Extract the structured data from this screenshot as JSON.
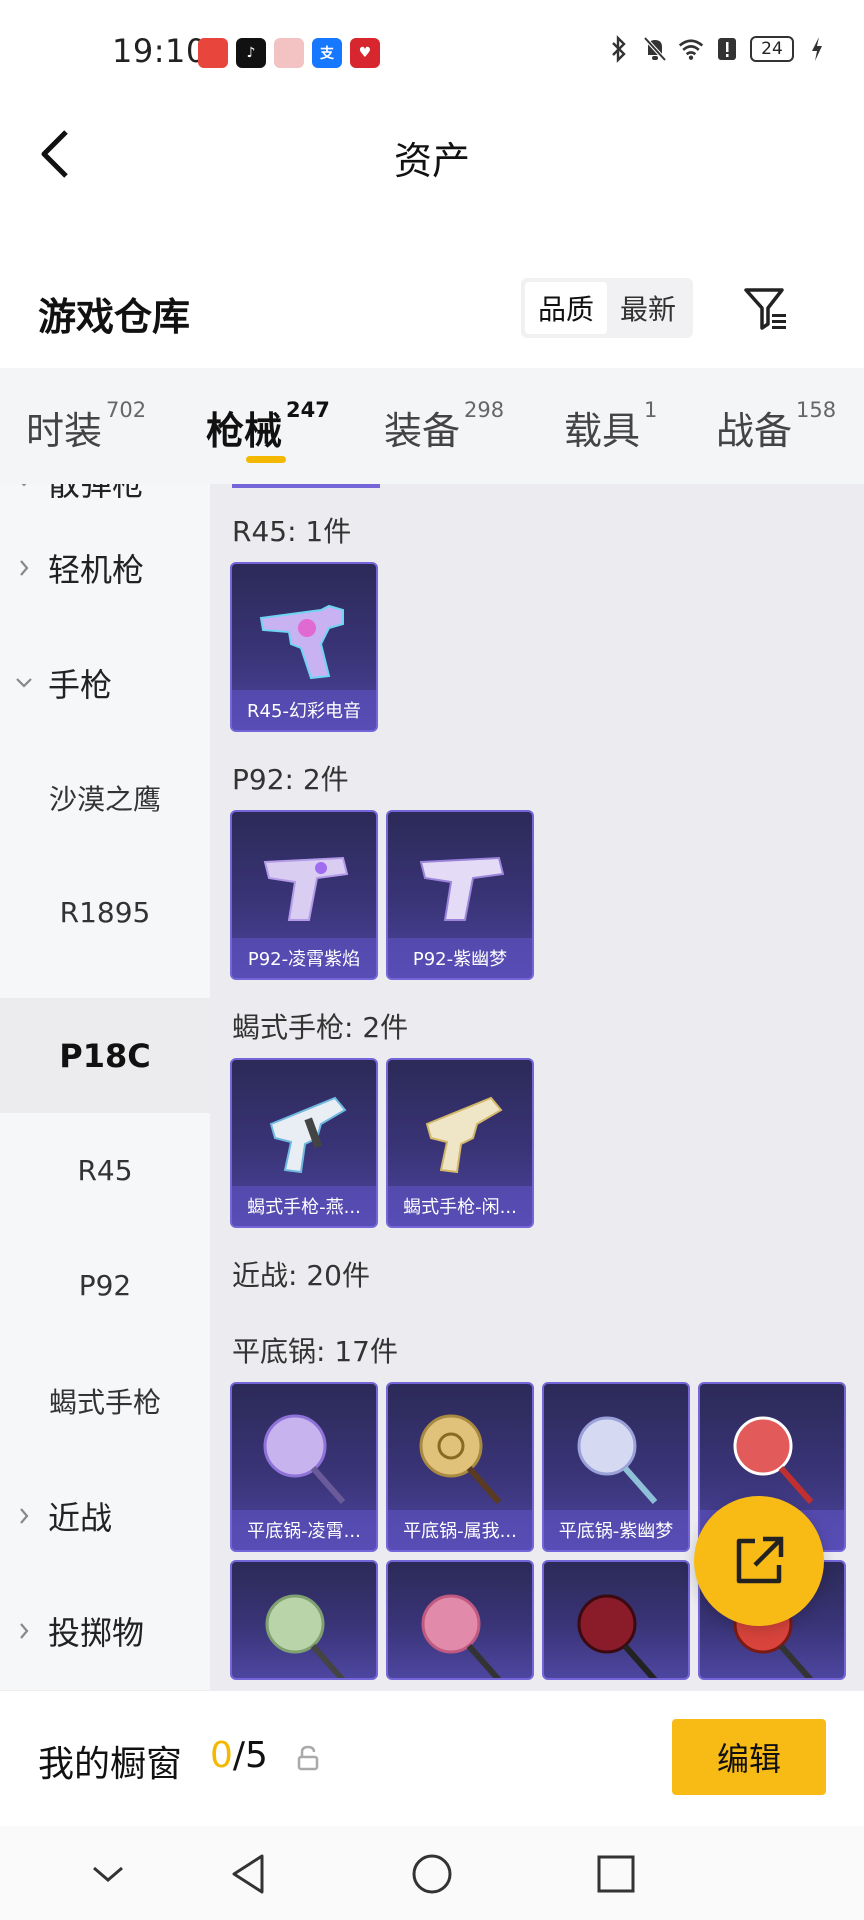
{
  "status_bar": {
    "time": "19:10",
    "apps": [
      {
        "name": "huawei-mall-icon",
        "label": "",
        "color": "#e8453c"
      },
      {
        "name": "tiktok-icon",
        "label": "♪",
        "color": "#111111"
      },
      {
        "name": "gift-box-icon",
        "label": "",
        "color": "#f1a7a7"
      },
      {
        "name": "alipay-icon",
        "label": "支",
        "color": "#1677ff"
      },
      {
        "name": "app-red-icon",
        "label": "♥",
        "color": "#d8262f"
      }
    ],
    "battery": "24"
  },
  "header": {
    "title": "资产"
  },
  "section": {
    "title": "游戏仓库",
    "sort_options": [
      "品质",
      "最新"
    ],
    "active_sort": "品质"
  },
  "tabs": [
    {
      "label": "时装",
      "count": "702"
    },
    {
      "label": "枪械",
      "count": "247"
    },
    {
      "label": "装备",
      "count": "298"
    },
    {
      "label": "载具",
      "count": "1"
    },
    {
      "label": "战备",
      "count": "158"
    }
  ],
  "sidebar": {
    "partial_top": "散弹枪",
    "items": [
      {
        "label": "轻机枪",
        "type": "group"
      },
      {
        "label": "手枪",
        "type": "group-open"
      },
      {
        "label": "沙漠之鹰",
        "type": "sub"
      },
      {
        "label": "R1895",
        "type": "sub"
      },
      {
        "label": "P18C",
        "type": "sub-selected"
      },
      {
        "label": "R45",
        "type": "sub"
      },
      {
        "label": "P92",
        "type": "sub"
      },
      {
        "label": "蝎式手枪",
        "type": "sub"
      },
      {
        "label": "近战",
        "type": "group"
      },
      {
        "label": "投掷物",
        "type": "group"
      }
    ]
  },
  "content": {
    "groups": [
      {
        "label": "R45: 1件",
        "items": [
          "R45-幻彩电音"
        ]
      },
      {
        "label": "P92: 2件",
        "items": [
          "P92-凌霄紫焰",
          "P92-紫幽梦"
        ]
      },
      {
        "label": "蝎式手枪: 2件",
        "items": [
          "蝎式手枪-燕...",
          "蝎式手枪-闲..."
        ]
      },
      {
        "label": "近战: 20件",
        "items": []
      },
      {
        "label": "平底锅: 17件",
        "items": [
          "平底锅-凌霄...",
          "平底锅-属我...",
          "平底锅-紫幽梦",
          ""
        ]
      }
    ]
  },
  "bottom": {
    "showcase_label": "我的橱窗",
    "showcase_current": "0",
    "showcase_total": "/5",
    "edit_label": "编辑"
  },
  "colors": {
    "accent": "#f8bb16",
    "card_bg": "#3a3478",
    "card_border": "#7466d9"
  }
}
